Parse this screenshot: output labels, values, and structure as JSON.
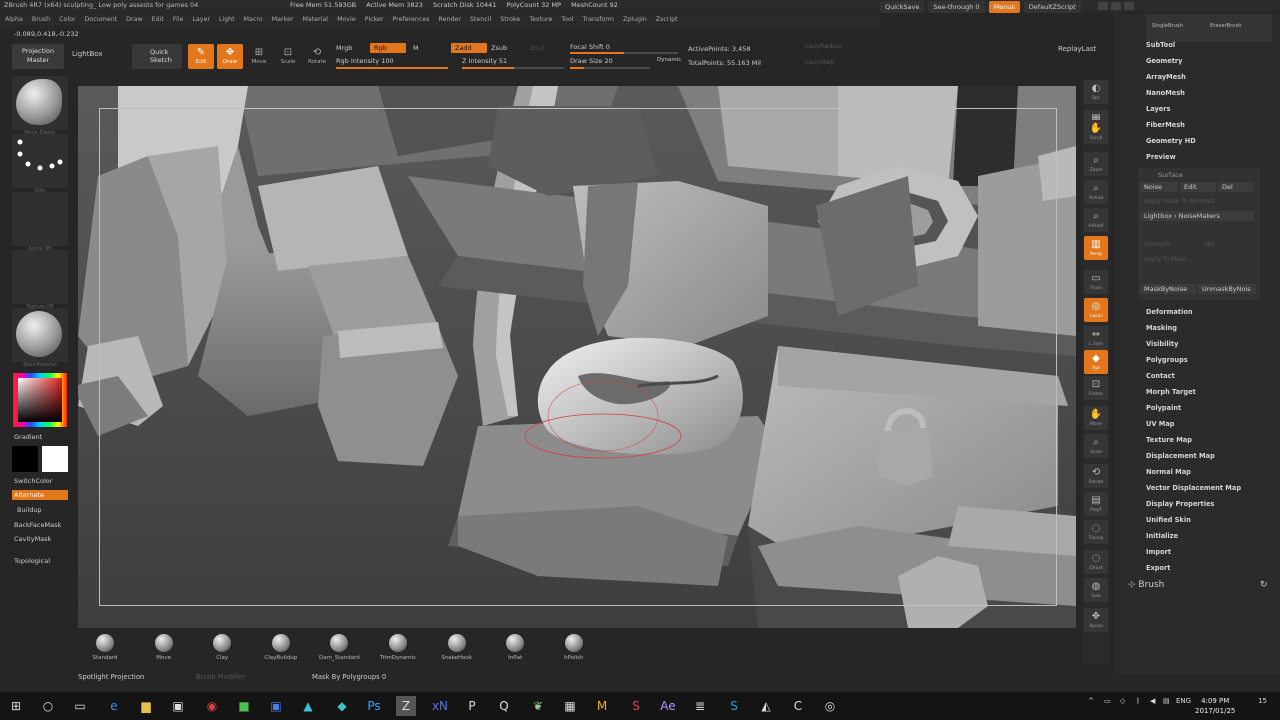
{
  "title": "ZBrush 4R7 (x64)   sculpting_ Low poly assests for games 04",
  "stats": [
    "Free Mem 51.593GB",
    "Active Mem 3823",
    "Scratch Disk 10441",
    "PolyCount 32 MP",
    "MeshCount 92"
  ],
  "menu": [
    "Alpha",
    "Brush",
    "Color",
    "Document",
    "Draw",
    "Edit",
    "File",
    "Layer",
    "Light",
    "Macro",
    "Marker",
    "Material",
    "Movie",
    "Picker",
    "Preferences",
    "Render",
    "Stencil",
    "Stroke",
    "Texture",
    "Tool",
    "Transform",
    "Zplugin",
    "Zscript"
  ],
  "topright": {
    "quicksave": "QuickSave",
    "seethrough": "See-through  0",
    "menus": "Menus",
    "defaultscript": "DefaultZScript"
  },
  "coords": "-0.089,0.418,-0.232",
  "shelf": {
    "projection": "Projection Master",
    "lightbox": "LightBox",
    "quicksketch": "Quick Sketch",
    "tools": [
      "Edit",
      "Draw",
      "Move",
      "Scale",
      "Rotate"
    ],
    "mrgb": "Mrgb",
    "rgb": "Rgb",
    "m": "M",
    "zadd": "Zadd",
    "zsub": "Zsub",
    "zcut": "Zcut",
    "rgb_intensity": "Rgb Intensity 100",
    "z_intensity": "Z Intensity 51",
    "focal_shift": "Focal Shift 0",
    "draw_size": "Draw Size 20",
    "dynamic": "Dynamic",
    "active_points": "ActivePoints: 3,458",
    "total_points": "TotalPoints: 55.163 Mil",
    "lazy_radius": "LazyRadius",
    "lazy_step": "LazyStep",
    "replay": "ReplayLast"
  },
  "left": {
    "brush_cap": "Move Elastic",
    "stroke_cap": "Dots",
    "alpha_cap": "Alpha Off",
    "texture_cap": "Texture Off",
    "material_cap": "BasicMaterial",
    "gradient": "Gradient",
    "switchcolor": "SwitchColor",
    "alternate": "Alternate",
    "buildup": "Buildup",
    "backface": "BackFaceMask",
    "cavity": "CavityMask",
    "topological": "Topological",
    "colors": {
      "main": "#ffffff",
      "secondary": "#000000"
    }
  },
  "vbar": [
    "Bpr",
    "SPix 3",
    "Scroll",
    "Zoom",
    "Actual",
    "AAHalf",
    "Persp",
    "Floor",
    "Local",
    "L.Sym",
    "Xyz",
    "Frame",
    "Move",
    "Scale",
    "Rotate",
    "PolyF",
    "Transp",
    "Ghost",
    "Solo",
    "Xpose"
  ],
  "right": {
    "top_brushes": [
      "SingleBrush",
      "EraserBrush"
    ],
    "items_a": [
      "SubTool",
      "Geometry",
      "ArrayMesh",
      "NanoMesh",
      "Layers",
      "FiberMesh",
      "Geometry HD",
      "Preview"
    ],
    "surface": {
      "header": "Surface",
      "noise": "Noise",
      "edit": "Edit",
      "del": "Del",
      "apply_normals": "Apply Noise To Normals",
      "lightbox_noise": "Lightbox › NoiseMakers",
      "strength": "Strength",
      "mix": "Mix",
      "apply_mesh": "Apply To Mesh",
      "mask_by_noise": "MaskByNoise",
      "unmask_by_noise": "UnmaskByNois"
    },
    "items_b": [
      "Deformation",
      "Masking",
      "Visibility",
      "Polygroups",
      "Contact",
      "Morph Target",
      "Polypaint",
      "UV Map",
      "Texture Map",
      "Displacement Map",
      "Normal Map",
      "Vector Displacement Map",
      "Display Properties",
      "Unified Skin",
      "Initialize",
      "Import",
      "Export"
    ],
    "brush_header": "Brush"
  },
  "brushes": [
    "Standard",
    "Move",
    "Clay",
    "ClayBuildup",
    "Dam_Standard",
    "TrimDynamic",
    "SnakeHook",
    "Inflat",
    "hPolish"
  ],
  "status": {
    "spotlight": "Spotlight Projection",
    "brush_modifier": "Brush Modifier",
    "mask_polygroups": "Mask By Polygroups 0"
  },
  "taskbar": {
    "lang": "ENG",
    "time": "4:09 PM",
    "date": "2017/01/25",
    "notif": "15"
  }
}
